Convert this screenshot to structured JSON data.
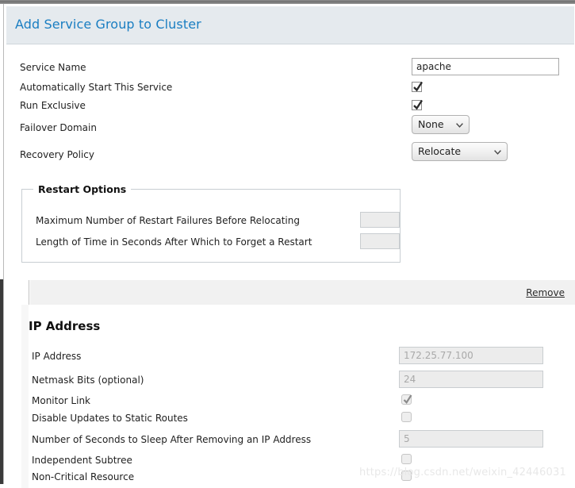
{
  "window": {
    "title": "Add Service Group to Cluster",
    "title_color": "#1a7ec2",
    "header_bg": "#e5eaee"
  },
  "service_form": {
    "rows": [
      {
        "label": "Service Name",
        "type": "text",
        "value": "apache"
      },
      {
        "label": "Automatically Start This Service",
        "type": "checkbox",
        "checked": true
      },
      {
        "label": "Run Exclusive",
        "type": "checkbox",
        "checked": true
      },
      {
        "label": "Failover Domain",
        "type": "select",
        "value": "None"
      },
      {
        "label": "Recovery Policy",
        "type": "select",
        "value": "Relocate"
      }
    ]
  },
  "restart_options": {
    "legend": "Restart Options",
    "rows": [
      {
        "label": "Maximum Number of Restart Failures Before Relocating",
        "value": ""
      },
      {
        "label": "Length of Time in Seconds After Which to Forget a Restart",
        "value": ""
      }
    ]
  },
  "resource_bar": {
    "remove_label": "Remove"
  },
  "ip_address_section": {
    "title": "IP Address",
    "rows": [
      {
        "label": "IP Address",
        "type": "text",
        "value": "172.25.77.100"
      },
      {
        "label": "Netmask Bits (optional)",
        "type": "text",
        "value": "24"
      },
      {
        "label": "Monitor Link",
        "type": "checkbox",
        "checked": true
      },
      {
        "label": "Disable Updates to Static Routes",
        "type": "checkbox",
        "checked": false
      },
      {
        "label": "Number of Seconds to Sleep After Removing an IP Address",
        "type": "text",
        "value": "5"
      },
      {
        "label": "Independent Subtree",
        "type": "checkbox",
        "checked": false
      },
      {
        "label": "Non-Critical Resource",
        "type": "checkbox",
        "checked": false
      }
    ]
  },
  "watermark": {
    "text": "https://blog.csdn.net/weixin_42446031"
  }
}
